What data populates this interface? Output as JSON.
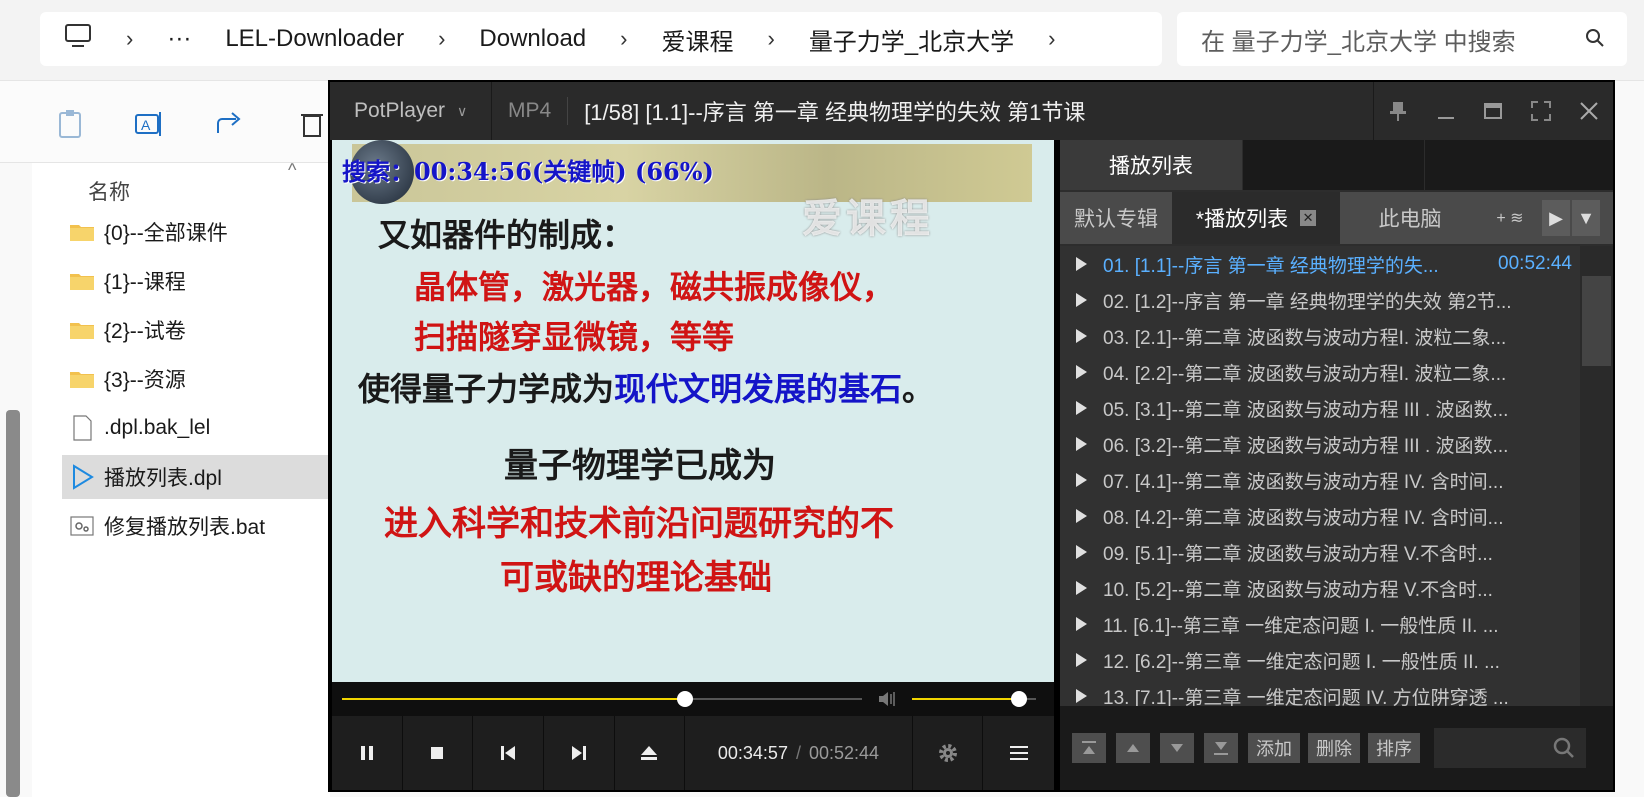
{
  "explorer": {
    "breadcrumb": [
      "LEL-Downloader",
      "Download",
      "爱课程",
      "量子力学_北京大学"
    ],
    "more": "···",
    "search_placeholder": "在 量子力学_北京大学 中搜索",
    "column_name": "名称",
    "files": [
      {
        "name": "{0}--全部课件",
        "type": "folder"
      },
      {
        "name": "{1}--课程",
        "type": "folder"
      },
      {
        "name": "{2}--试卷",
        "type": "folder"
      },
      {
        "name": "{3}--资源",
        "type": "folder"
      },
      {
        "name": ".dpl.bak_lel",
        "type": "file"
      },
      {
        "name": "播放列表.dpl",
        "type": "playlist"
      },
      {
        "name": "修复播放列表.bat",
        "type": "batch"
      }
    ]
  },
  "player": {
    "brand": "PotPlayer",
    "format": "MP4",
    "file_title": "[1/58] [1.1]--序言 第一章 经典物理学的失效 第1节课",
    "osd": "搜索：00:34:56(关键帧) (66%)",
    "watermark": "爱课程",
    "slide": {
      "line1": "又如器件的制成：",
      "line2": "晶体管，激光器，磁共振成像仪，",
      "line3": "扫描隧穿显微镜，等等",
      "line4a": "使得量子力学成为",
      "line4b": "现代文明发展的基石",
      "line4c": "。",
      "line5": "量子物理学已成为",
      "line6": "进入科学和技术前沿问题研究的不",
      "line7": "可或缺的理论基础"
    },
    "seek_progress": 0.66,
    "volume_level": 0.86,
    "current_time": "00:34:57",
    "time_sep": "/",
    "duration": "00:52:44"
  },
  "playlist": {
    "header": "播放列表",
    "tabs": [
      "默认专辑",
      "*播放列表",
      "此电脑",
      "+ ≋"
    ],
    "items": [
      {
        "label": "01. [1.1]--序言 第一章 经典物理学的失...",
        "duration": "00:52:44"
      },
      {
        "label": "02. [1.2]--序言 第一章 经典物理学的失效 第2节...",
        "duration": ""
      },
      {
        "label": "03. [2.1]--第二章 波函数与波动方程I. 波粒二象...",
        "duration": ""
      },
      {
        "label": "04. [2.2]--第二章 波函数与波动方程I. 波粒二象...",
        "duration": ""
      },
      {
        "label": "05. [3.1]--第二章 波函数与波动方程 III . 波函数...",
        "duration": ""
      },
      {
        "label": "06. [3.2]--第二章 波函数与波动方程 III . 波函数...",
        "duration": ""
      },
      {
        "label": "07. [4.1]--第二章 波函数与波动方程 IV. 含时间...",
        "duration": ""
      },
      {
        "label": "08. [4.2]--第二章 波函数与波动方程 IV. 含时间...",
        "duration": ""
      },
      {
        "label": "09. [5.1]--第二章 波函数与波动方程 V.不含时...",
        "duration": ""
      },
      {
        "label": "10. [5.2]--第二章 波函数与波动方程 V.不含时...",
        "duration": ""
      },
      {
        "label": "11. [6.1]--第三章 一维定态问题 I. 一般性质 II. ...",
        "duration": ""
      },
      {
        "label": "12. [6.2]--第三章 一维定态问题 I. 一般性质 II. ...",
        "duration": ""
      },
      {
        "label": "13. [7.1]--第三章 一维定态问题 IV. 方位阱穿透 ...",
        "duration": ""
      }
    ],
    "buttons": {
      "add": "添加",
      "delete": "删除",
      "sort": "排序"
    }
  },
  "colors": {
    "accent": "#f1d500",
    "current_item": "#5ab0ff",
    "osd": "#1515c8"
  }
}
